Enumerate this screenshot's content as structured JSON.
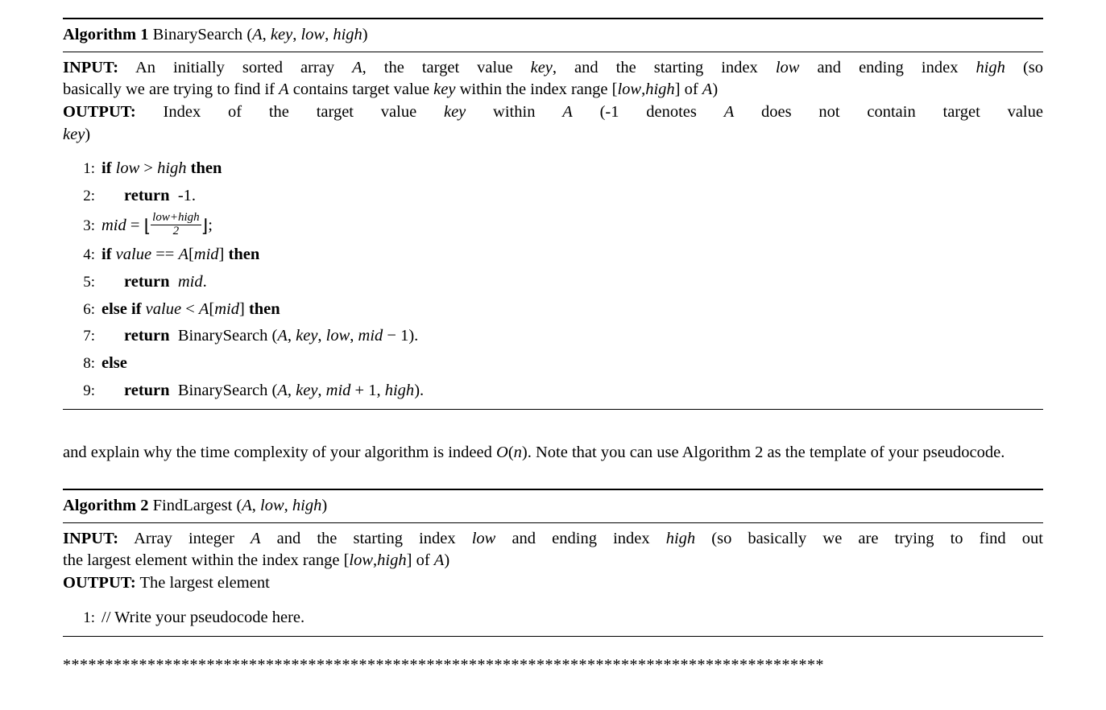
{
  "algo1": {
    "label": "Algorithm 1",
    "name": "BinarySearch",
    "params_html": "(<span class=\"it\">A</span>, <span class=\"it\">key</span>, <span class=\"it\">low</span>, <span class=\"it\">high</span>)",
    "desc_html": "<span class=\"jline\"><span class=\"bf\">INPUT:</span> An initially sorted array <span class=\"it\">A</span>, the target value <span class=\"it\">key</span>, and the starting index <span class=\"it\">low</span> and ending index <span class=\"it\">high</span> (so</span><span class=\"lline\">basically we are trying to find if <span class=\"it\">A</span> contains target value <span class=\"it\">key</span> within the index range [<span class=\"it\">low</span>,<span class=\"it\">high</span>] of <span class=\"it\">A</span>)</span><span class=\"jline\"><span class=\"bf\">OUTPUT:</span> Index of the target value <span class=\"it\">key</span> within <span class=\"it\">A</span> (-1 denotes <span class=\"it\">A</span> does not contain target value</span><span class=\"lline\"><span class=\"it\">key</span>)</span>",
    "lines": [
      {
        "n": "1:",
        "indent": 0,
        "html": "<span class=\"bf\">if</span> <span class=\"it\">low</span> &gt; <span class=\"it\">high</span> <span class=\"bf\">then</span>"
      },
      {
        "n": "2:",
        "indent": 1,
        "html": "<span class=\"bf\">return</span>&nbsp; -1."
      },
      {
        "n": "3:",
        "indent": 0,
        "html": "<span class=\"it\">mid</span> = <span class=\"floorL\">⌊</span><span class=\"frac\"><span class=\"top\">low+high</span><span class=\"bot\">2</span></span><span class=\"floorR\">⌋</span>;"
      },
      {
        "n": "4:",
        "indent": 0,
        "html": "<span class=\"bf\">if</span> <span class=\"it\">value</span> == <span class=\"it\">A</span>[<span class=\"it\">mid</span>] <span class=\"bf\">then</span>"
      },
      {
        "n": "5:",
        "indent": 1,
        "html": "<span class=\"bf\">return</span>&nbsp; <span class=\"it\">mid</span>."
      },
      {
        "n": "6:",
        "indent": 0,
        "html": "<span class=\"bf\">else if</span> <span class=\"it\">value</span> &lt; <span class=\"it\">A</span>[<span class=\"it\">mid</span>] <span class=\"bf\">then</span>"
      },
      {
        "n": "7:",
        "indent": 1,
        "html": "<span class=\"bf\">return</span>&nbsp; BinarySearch (<span class=\"it\">A</span>, <span class=\"it\">key</span>, <span class=\"it\">low</span>, <span class=\"it\">mid</span> − 1)."
      },
      {
        "n": "8:",
        "indent": 0,
        "html": "<span class=\"bf\">else</span>"
      },
      {
        "n": "9:",
        "indent": 1,
        "html": "<span class=\"bf\">return</span>&nbsp; BinarySearch (<span class=\"it\">A</span>, <span class=\"it\">key</span>, <span class=\"it\">mid</span> + 1, <span class=\"it\">high</span>)."
      }
    ]
  },
  "para_html": "and explain why the time complexity of your algorithm is indeed <span class=\"it\">O</span>(<span class=\"it\">n</span>). Note that you can use Algorithm 2 as the template of your pseudocode.",
  "algo2": {
    "label": "Algorithm 2",
    "name": "FindLargest",
    "params_html": "(<span class=\"it\">A</span>, <span class=\"it\">low</span>, <span class=\"it\">high</span>)",
    "desc_html": "<span class=\"jline\"><span class=\"bf\">INPUT:</span> Array integer <span class=\"it\">A</span> and the starting index <span class=\"it\">low</span> and ending index <span class=\"it\">high</span> (so basically we are trying to find out</span><span class=\"lline\">the largest element within the index range [<span class=\"it\">low</span>,<span class=\"it\">high</span>] of <span class=\"it\">A</span>)</span><span class=\"lline\"><span class=\"bf\">OUTPUT:</span> The largest element</span>",
    "lines": [
      {
        "n": "1:",
        "indent": 0,
        "html": "// Write your pseudocode here."
      }
    ]
  },
  "stars": "******************************************************************************************"
}
